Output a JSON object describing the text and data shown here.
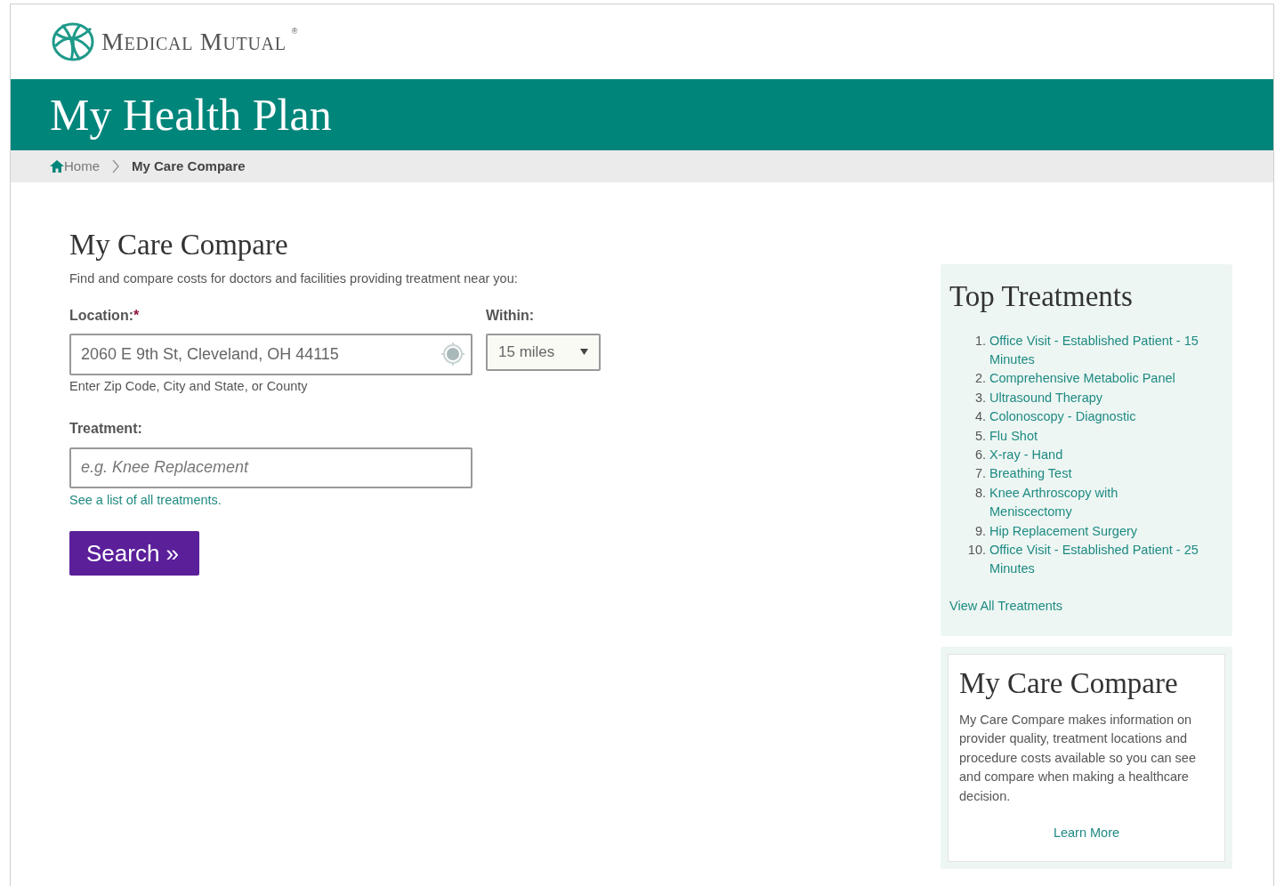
{
  "header": {
    "logo_text": "Medical Mutual",
    "logo_mark": "®"
  },
  "banner": {
    "title": "My Health Plan"
  },
  "breadcrumb": [
    {
      "label": "Home",
      "kind": "home"
    },
    {
      "label": "My Care Compare",
      "kind": "current"
    }
  ],
  "search_form": {
    "title": "My Care Compare",
    "intro": "Find and compare costs for doctors and facilities providing treatment near you:",
    "location": {
      "label": "Location:",
      "required_mark": "*",
      "value": "2060 E 9th St, Cleveland, OH 44115",
      "hint": "Enter Zip Code, City and State, or County"
    },
    "within": {
      "label": "Within:",
      "value": "15 miles"
    },
    "treatment": {
      "label": "Treatment:",
      "placeholder": "e.g. Knee Replacement",
      "link": "See a list of all treatments."
    },
    "button": "Search »"
  },
  "top_treatments": {
    "title": "Top Treatments",
    "items": [
      {
        "number": "1.",
        "label": "Office Visit - Established Patient - 15 Minutes"
      },
      {
        "number": "2.",
        "label": "Comprehensive Metabolic Panel"
      },
      {
        "number": "3.",
        "label": "Ultrasound Therapy"
      },
      {
        "number": "4.",
        "label": "Colonoscopy - Diagnostic"
      },
      {
        "number": "5.",
        "label": "Flu Shot"
      },
      {
        "number": "6.",
        "label": "X-ray - Hand"
      },
      {
        "number": "7.",
        "label": "Breathing Test"
      },
      {
        "number": "8.",
        "label": "Knee Arthroscopy with Meniscectomy"
      },
      {
        "number": "9.",
        "label": "Hip Replacement Surgery"
      },
      {
        "number": "10.",
        "label": "Office Visit - Established Patient - 25 Minutes"
      }
    ],
    "view_all": "View All Treatments"
  },
  "about": {
    "title": "My Care Compare",
    "text": "My Care Compare makes information on provider quality, treatment locations and procedure costs available so you can see and compare when making a healthcare decision.",
    "link": "Learn More"
  }
}
